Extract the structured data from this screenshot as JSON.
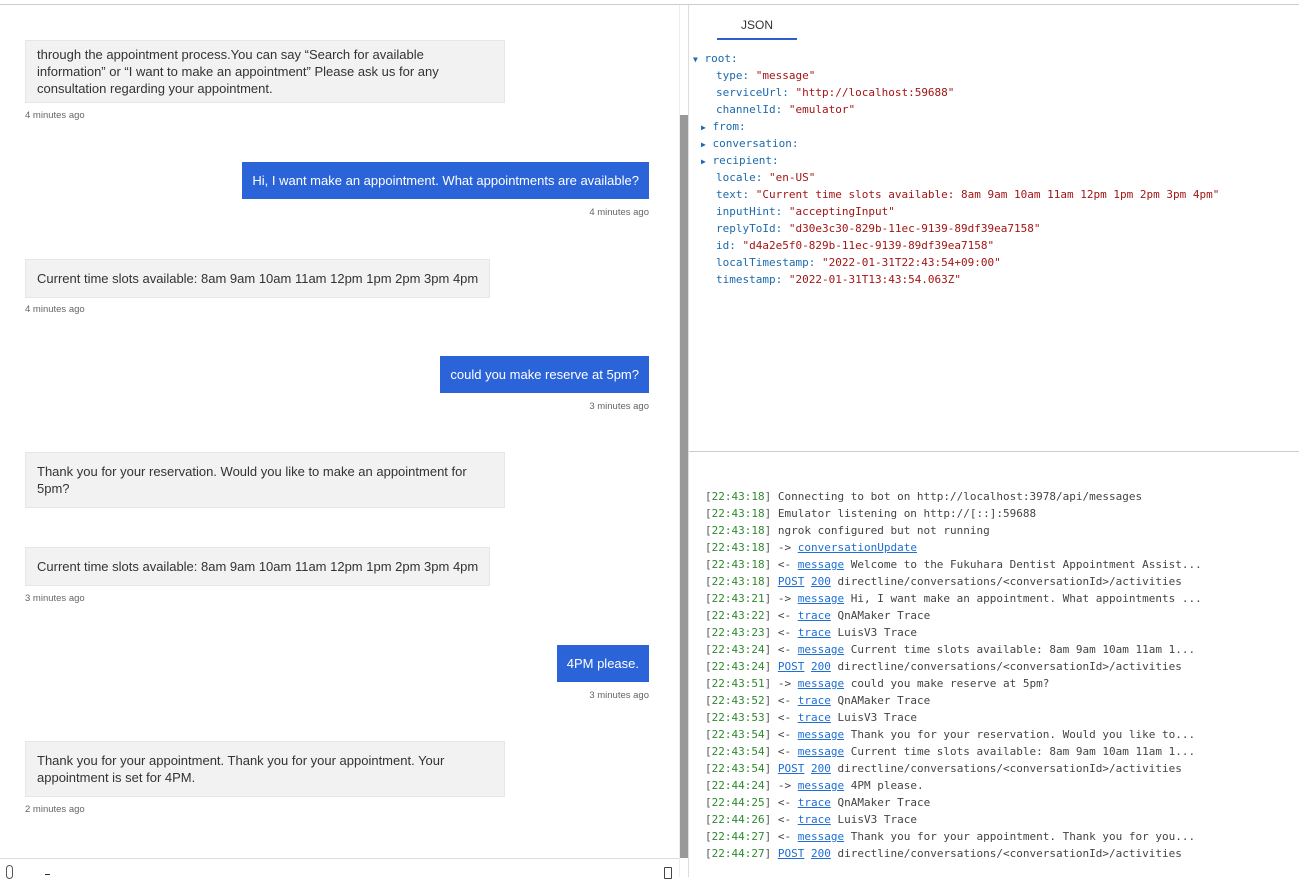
{
  "chat": {
    "messages": [
      {
        "from": "bot",
        "text": "through the appointment process.You can say “Search for available information” or “I want to make an appointment” Please ask us for any consultation regarding your appointment.",
        "time": "4 minutes ago"
      },
      {
        "from": "user",
        "text": "Hi, I want make an appointment. What appointments are available?",
        "time": "4 minutes ago"
      },
      {
        "from": "bot",
        "text": "Current time slots available: 8am 9am 10am 11am 12pm 1pm 2pm 3pm 4pm",
        "time": "4 minutes ago"
      },
      {
        "from": "user",
        "text": "could you make reserve at 5pm?",
        "time": "3 minutes ago"
      },
      {
        "from": "bot",
        "text": "Thank you for your reservation. Would you like to make an appointment for 5pm?"
      },
      {
        "from": "bot",
        "text": "Current time slots available: 8am 9am 10am 11am 12pm 1pm 2pm 3pm 4pm",
        "time": "3 minutes ago"
      },
      {
        "from": "user",
        "text": "4PM please.",
        "time": "3 minutes ago"
      },
      {
        "from": "bot",
        "text": "Thank you for your appointment. Thank you for your appointment. Your appointment is set for 4PM.",
        "time": "2 minutes ago"
      }
    ]
  },
  "inspector": {
    "tab": "JSON",
    "root_label": "root:",
    "fields": [
      {
        "key": "type:",
        "value": "\"message\""
      },
      {
        "key": "serviceUrl:",
        "value": "\"http://localhost:59688\""
      },
      {
        "key": "channelId:",
        "value": "\"emulator\""
      },
      {
        "key": "from:",
        "collapsed": true
      },
      {
        "key": "conversation:",
        "collapsed": true
      },
      {
        "key": "recipient:",
        "collapsed": true
      },
      {
        "key": "locale:",
        "value": "\"en-US\""
      },
      {
        "key": "text:",
        "value": "\"Current time slots available: 8am 9am 10am 11am 12pm 1pm 2pm 3pm 4pm\""
      },
      {
        "key": "inputHint:",
        "value": "\"acceptingInput\""
      },
      {
        "key": "replyToId:",
        "value": "\"d30e3c30-829b-11ec-9139-89df39ea7158\""
      },
      {
        "key": "id:",
        "value": "\"d4a2e5f0-829b-11ec-9139-89df39ea7158\""
      },
      {
        "key": "localTimestamp:",
        "value": "\"2022-01-31T22:43:54+09:00\""
      },
      {
        "key": "timestamp:",
        "value": "\"2022-01-31T13:43:54.063Z\""
      }
    ]
  },
  "log": [
    {
      "t": "22:43:18",
      "text": "Connecting to bot on http://localhost:3978/api/messages"
    },
    {
      "t": "22:43:18",
      "text": "Emulator listening on http://[::]:59688"
    },
    {
      "t": "22:43:18",
      "text": "ngrok configured but not running"
    },
    {
      "t": "22:43:18",
      "dir": "->",
      "link": "conversationUpdate",
      "text": ""
    },
    {
      "t": "22:43:18",
      "dir": "<-",
      "link": "message",
      "text": "Welcome to the Fukuhara Dentist Appointment Assist..."
    },
    {
      "t": "22:43:18",
      "post": "POST",
      "code": "200",
      "text": "directline/conversations/<conversationId>/activities"
    },
    {
      "t": "22:43:21",
      "dir": "->",
      "link": "message",
      "text": "Hi, I want make an appointment. What appointments ..."
    },
    {
      "t": "22:43:22",
      "dir": "<-",
      "link": "trace",
      "text": "QnAMaker Trace"
    },
    {
      "t": "22:43:23",
      "dir": "<-",
      "link": "trace",
      "text": "LuisV3 Trace"
    },
    {
      "t": "22:43:24",
      "dir": "<-",
      "link": "message",
      "text": "Current time slots available: 8am 9am 10am 11am 1..."
    },
    {
      "t": "22:43:24",
      "post": "POST",
      "code": "200",
      "text": "directline/conversations/<conversationId>/activities"
    },
    {
      "t": "22:43:51",
      "dir": "->",
      "link": "message",
      "text": "could you make reserve at 5pm?"
    },
    {
      "t": "22:43:52",
      "dir": "<-",
      "link": "trace",
      "text": "QnAMaker Trace"
    },
    {
      "t": "22:43:53",
      "dir": "<-",
      "link": "trace",
      "text": "LuisV3 Trace"
    },
    {
      "t": "22:43:54",
      "dir": "<-",
      "link": "message",
      "text": "Thank you for your reservation. Would you like to..."
    },
    {
      "t": "22:43:54",
      "dir": "<-",
      "link": "message",
      "text": "Current time slots available: 8am 9am 10am 11am 1..."
    },
    {
      "t": "22:43:54",
      "post": "POST",
      "code": "200",
      "text": "directline/conversations/<conversationId>/activities"
    },
    {
      "t": "22:44:24",
      "dir": "->",
      "link": "message",
      "text": "4PM please."
    },
    {
      "t": "22:44:25",
      "dir": "<-",
      "link": "trace",
      "text": "QnAMaker Trace"
    },
    {
      "t": "22:44:26",
      "dir": "<-",
      "link": "trace",
      "text": "LuisV3 Trace"
    },
    {
      "t": "22:44:27",
      "dir": "<-",
      "link": "message",
      "text": "Thank you for your appointment. Thank you for you..."
    },
    {
      "t": "22:44:27",
      "post": "POST",
      "code": "200",
      "text": "directline/conversations/<conversationId>/activities"
    }
  ]
}
